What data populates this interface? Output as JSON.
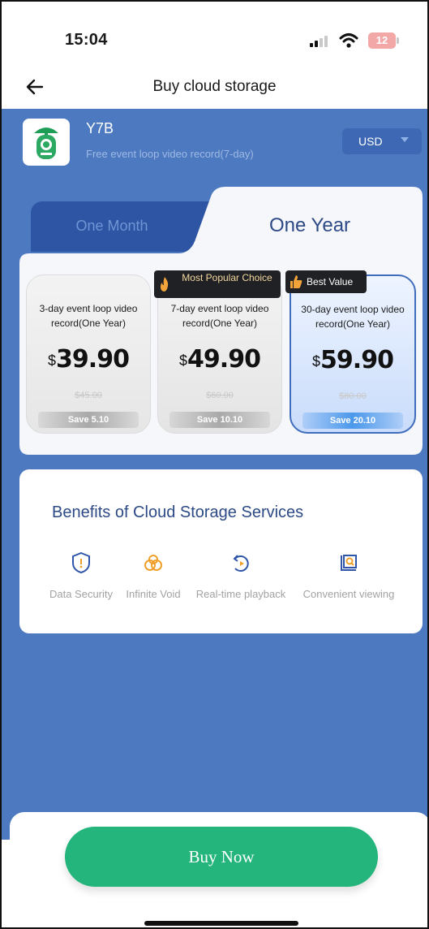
{
  "status_bar": {
    "time": "15:04",
    "battery": "12"
  },
  "nav": {
    "title": "Buy cloud storage",
    "back_icon": "arrow-left-icon"
  },
  "device": {
    "name": "Y7B",
    "subtitle": "Free event loop video record(7-day)",
    "currency": "USD"
  },
  "tabs": {
    "month_label": "One Month",
    "year_label": "One Year",
    "active": "One Year"
  },
  "plans": [
    {
      "desc": "3-day event loop video record(One Year)",
      "currency": "$",
      "price": "39.90",
      "original": "$45.00",
      "save": "Save 5.10",
      "badge": ""
    },
    {
      "desc": "7-day event loop video record(One Year)",
      "currency": "$",
      "price": "49.90",
      "original": "$60.00",
      "save": "Save 10.10",
      "badge": "Most Popular Choice"
    },
    {
      "desc": "30-day event loop video record(One Year)",
      "currency": "$",
      "price": "59.90",
      "original": "$80.00",
      "save": "Save 20.10",
      "badge": "Best Value",
      "selected": true
    }
  ],
  "benefits": {
    "title": "Benefits of Cloud Storage Services",
    "items": [
      {
        "label": "Data Security",
        "icon": "shield-icon"
      },
      {
        "label": "Infinite Void",
        "icon": "infinity-icon"
      },
      {
        "label": "Real-time playback",
        "icon": "replay-icon"
      },
      {
        "label": "Convenient viewing",
        "icon": "search-screen-icon"
      }
    ]
  },
  "buy_button": "Buy Now",
  "colors": {
    "primary_blue": "#4c79bf",
    "accent_green": "#23b57b",
    "selected_border": "#3f6dbb"
  }
}
